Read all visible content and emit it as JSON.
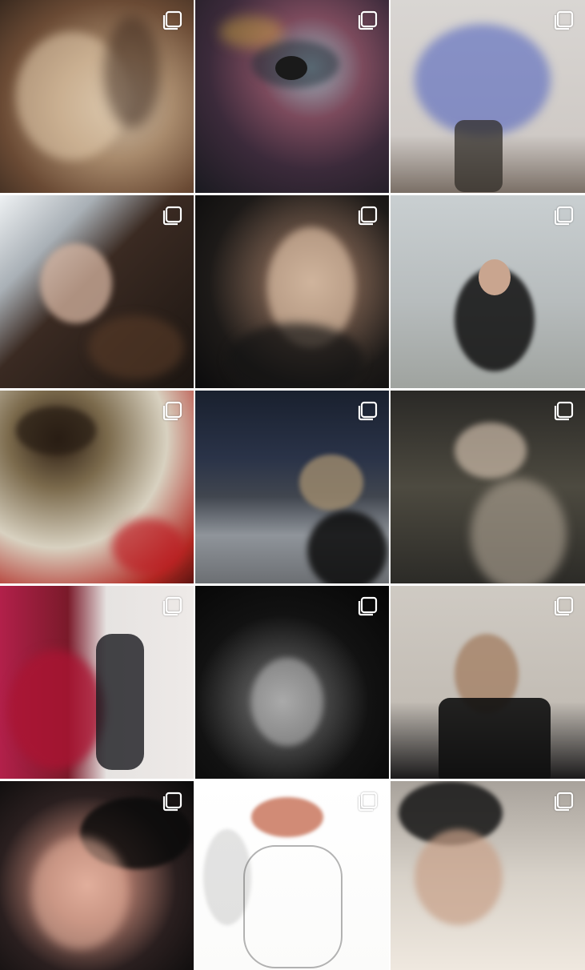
{
  "grid": {
    "posts": [
      {
        "id": "post-1",
        "multi_image": true
      },
      {
        "id": "post-2",
        "multi_image": true
      },
      {
        "id": "post-3",
        "multi_image": true
      },
      {
        "id": "post-4",
        "multi_image": true
      },
      {
        "id": "post-5",
        "multi_image": true
      },
      {
        "id": "post-6",
        "multi_image": true
      },
      {
        "id": "post-7",
        "multi_image": true
      },
      {
        "id": "post-8",
        "multi_image": true
      },
      {
        "id": "post-9",
        "multi_image": true
      },
      {
        "id": "post-10",
        "multi_image": true
      },
      {
        "id": "post-11",
        "multi_image": true
      },
      {
        "id": "post-12",
        "multi_image": true
      },
      {
        "id": "post-13",
        "multi_image": true
      },
      {
        "id": "post-14",
        "multi_image": true
      },
      {
        "id": "post-15",
        "multi_image": true
      }
    ],
    "icons": {
      "multi_image": "carousel-icon"
    },
    "colors": {
      "icon": "#ffffff",
      "background": "#ffffff"
    }
  }
}
